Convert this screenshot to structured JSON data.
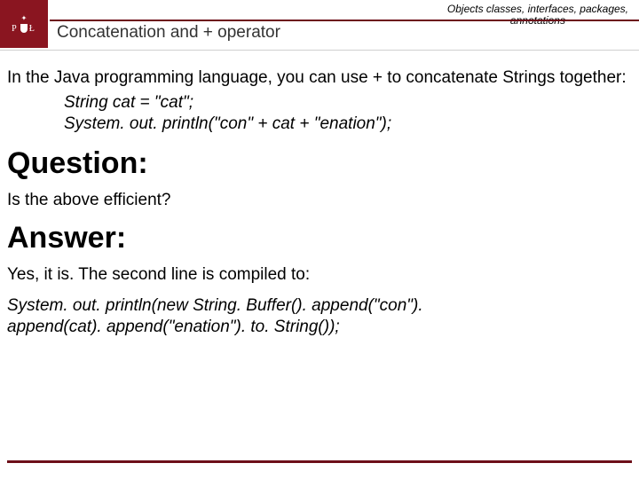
{
  "header": {
    "category_line1": "Objects classes, interfaces, packages,",
    "category_line2": "annotations",
    "title": "Concatenation and + operator",
    "logo_letters_left": "P",
    "logo_letters_right": "Ł"
  },
  "body": {
    "intro": "In the Java programming language, you can use + to concatenate Strings together:",
    "code_line1": "String cat = \"cat\";",
    "code_line2": "System. out. println(\"con\" + cat + \"enation\");",
    "question_heading": "Question:",
    "question_text": "Is the above efficient?",
    "answer_heading": "Answer:",
    "answer_text": "Yes, it is. The second line is compiled to:",
    "compiled_line1": "System. out. println(new String. Buffer(). append(\"con\").",
    "compiled_line2": "append(cat). append(\"enation\"). to. String());"
  }
}
